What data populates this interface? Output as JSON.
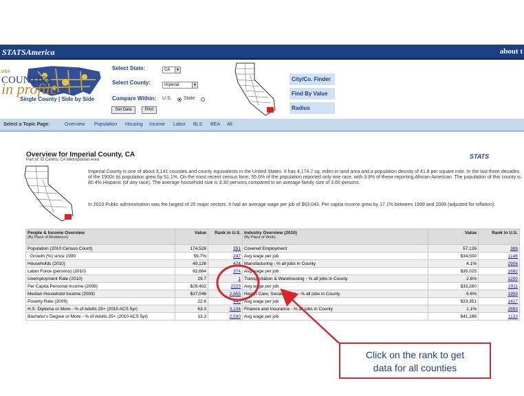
{
  "topbar": {
    "logo": "STATSAmerica",
    "about": "about t"
  },
  "header": {
    "logo_small": "USA",
    "logo_counties": "COUNTIES",
    "logo_profile": "in profile",
    "links": "Single County | Side by Side",
    "select_state_label": "Select State:",
    "state_value": "CA",
    "select_county_label": "Select County:",
    "county_value": "Imperial",
    "compare_label": "Compare Within:",
    "get_data_button": "Get Data",
    "print_button": "Print",
    "radio_us": "U.S.",
    "radio_state": "State"
  },
  "tools": [
    "City/Co. Finder",
    "Find By Value",
    "Radius"
  ],
  "topic_nav": {
    "lead": "Select a Topic Page:",
    "items": [
      "Overview",
      "Population",
      "Housing",
      "Income",
      "Labor",
      "BLS",
      "BEA",
      "All"
    ]
  },
  "overview": {
    "title": "Overview for Imperial County, CA",
    "subtitle": "Part of: El Centro, CA Metropolitan Area",
    "stats_logo": "STATS",
    "paragraph_1": "Imperial County is one of about 3,141 counties and county equivalents in the United States. It has 4,174.7 sq. miles in land area and a population density of 41.8 per square mile. In the last three decades of the 1900s its population grew by 51.1%. On the most recent census form, 55.6% of the population reported only one race, with 3.9% of these reporting African-American. The population of this county is 80.4% Hispanic (of any race). The average household size is 3.30 persons compared to an average family size of 3.60 persons.",
    "paragraph_2": "In 2010 Public administration was the largest of 20 major sectors. It had an average wage per job of $63,043. Per capita income grew by 17.1% between 1999 and 2009 (adjusted for inflation)."
  },
  "table": {
    "left_header": "People & Income Overview",
    "left_header_sub": "(By Place of Residence)",
    "value_header": "Value",
    "rank_header": "Rank in U.S.",
    "right_header": "Industry Overview (2010)",
    "right_header_sub": "(By Place of Work)",
    "rows": [
      {
        "l": "Population (2010 Census Count)",
        "lv": "174,528",
        "lr": "351",
        "r": "Covered Employment",
        "rv": "57,126",
        "rr": "389"
      },
      {
        "l": "Growth (%) since 1990",
        "lv": "59.7%",
        "lr": "247",
        "r": "Avg wage per job",
        "rv": "$34,500",
        "rr": "1146"
      },
      {
        "l": "Households (2010)",
        "lv": "49,126",
        "lr": "474",
        "r": "Manufacturing - % all jobs in County",
        "rv": "4.1%",
        "rr": "2906"
      },
      {
        "l": "Labor Force (persons) (2010)",
        "lv": "82,664",
        "lr": "374",
        "r": "Avg wage per job",
        "rv": "$35,025",
        "rr": "1682"
      },
      {
        "l": "Unemployment Rate (2010)",
        "lv": "29.7",
        "lr": "1",
        "r": "Transportation & Warehousing - % all jobs in County",
        "rv": "2.6%",
        "rr": "1200"
      },
      {
        "l": "Per Capita Personal Income (2009)",
        "lv": "$29,402",
        "lr": "2223",
        "r": "Avg wage per job",
        "rv": "$33,280",
        "rr": "2911"
      },
      {
        "l": "Median Household Income (2009)",
        "lv": "$37,046",
        "lr": "2,655",
        "r": "Health Care, Social Assist. - % all jobs in County",
        "rv": "6.6%",
        "rr": "1959"
      },
      {
        "l": "Poverty Rate (2009)",
        "lv": "22.6",
        "lr": "440",
        "r": "Avg wage per job",
        "rv": "$33,351",
        "rr": "1417"
      },
      {
        "l": "H.S. Diploma or More - % of Adults 25+ (2010 ACS 5yr)",
        "lv": "63.3",
        "lr": "3,134",
        "r": "Finance and Insurance - % all jobs in County",
        "rv": "1.1%",
        "rr": "2883"
      },
      {
        "l": "Bachelor's Degree or More - % of Adults 25+ (2010 ACS 5yr)",
        "lv": "13.3",
        "lr": "2,590",
        "r": "Avg wage per job",
        "rv": "$41,186",
        "rr": "1133"
      }
    ]
  },
  "callout": {
    "line1": "Click on the rank to get",
    "line2": "data for all counties"
  },
  "colors": {
    "nav_blue": "#1c3f82",
    "callout_red": "#d6262a",
    "topic_bar": "#c5d9ed"
  }
}
